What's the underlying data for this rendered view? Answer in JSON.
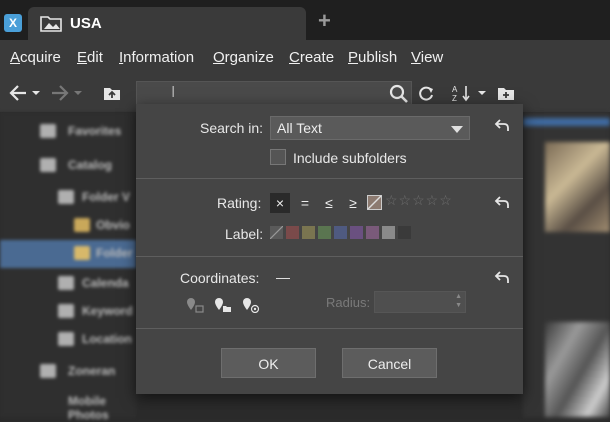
{
  "window": {
    "tab_title": "USA",
    "app_icon_glyph": "X"
  },
  "menu": {
    "items": [
      {
        "first": "A",
        "rest": "cquire"
      },
      {
        "first": "E",
        "rest": "dit"
      },
      {
        "first": "I",
        "rest": "nformation"
      },
      {
        "first": "O",
        "rest": "rganize"
      },
      {
        "first": "C",
        "rest": "reate"
      },
      {
        "first": "P",
        "rest": "ublish"
      },
      {
        "first": "V",
        "rest": "iew"
      }
    ]
  },
  "sidebar": {
    "items": [
      {
        "label": "Favorites"
      },
      {
        "label": "Catalog"
      },
      {
        "label": "Folder V"
      },
      {
        "label": "Obvio"
      },
      {
        "label": "Folder"
      },
      {
        "label": "Calenda"
      },
      {
        "label": "Keyword"
      },
      {
        "label": "Location"
      },
      {
        "label": "Zoneran"
      },
      {
        "label": "Mobile Photos"
      }
    ]
  },
  "search_dialog": {
    "search_in_label": "Search in:",
    "search_in_value": "All Text",
    "include_subfolders_label": "Include subfolders",
    "include_subfolders_checked": false,
    "rating_label": "Rating:",
    "rating_ops": [
      "×",
      "=",
      "≤",
      "≥"
    ],
    "rating_stars": "☆☆☆☆☆",
    "label_label": "Label:",
    "label_colors": [
      "#5a5a5a",
      "#7a4a4a",
      "#7a7550",
      "#5a7550",
      "#4f5a80",
      "#6a5080",
      "#7a5a7a",
      "#8a8a8a",
      "#3a3a3a"
    ],
    "coordinates_label": "Coordinates:",
    "coordinates_value": "—",
    "radius_label": "Radius:",
    "ok_label": "OK",
    "cancel_label": "Cancel"
  },
  "colors": {
    "accent": "#4a6a92",
    "dialog_bg": "#454545"
  },
  "icons": {
    "back": "arrow-left-icon",
    "forward": "arrow-right-icon",
    "up_folder": "folder-up-icon",
    "search": "search-icon",
    "refresh": "refresh-icon",
    "sort": "sort-az-icon",
    "new_folder": "new-folder-icon",
    "reset": "undo-icon"
  }
}
